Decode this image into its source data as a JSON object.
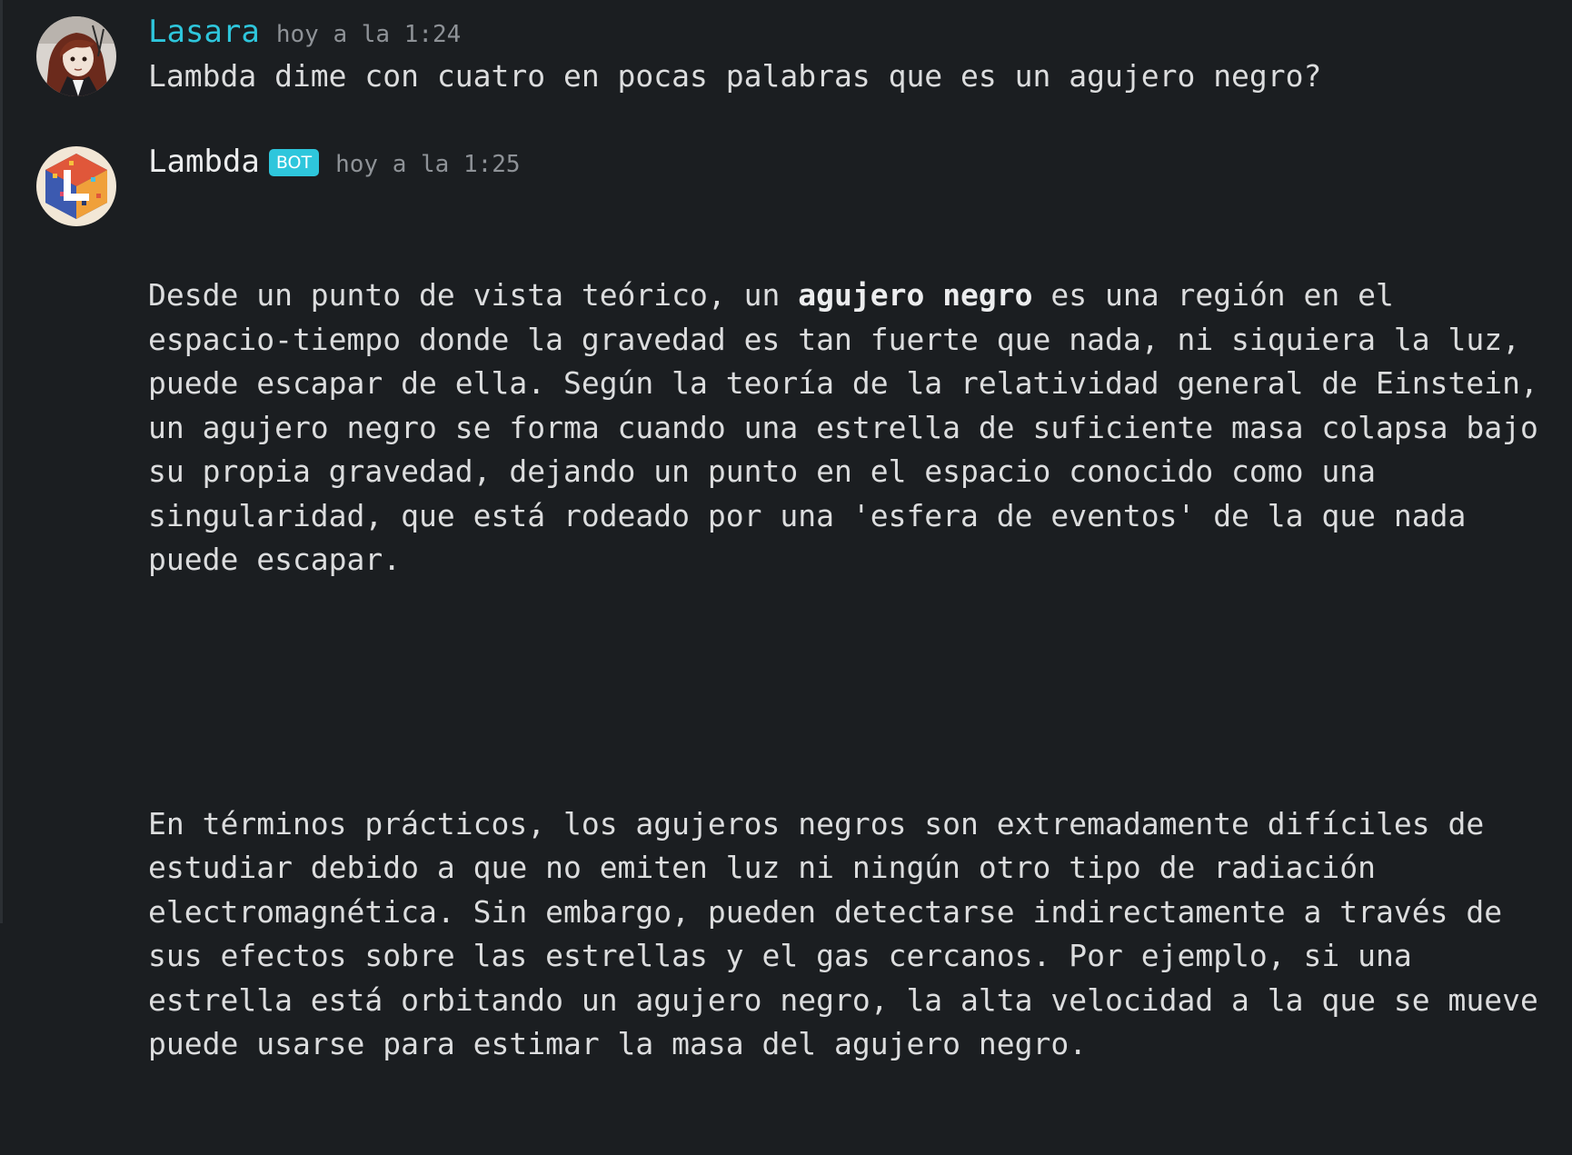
{
  "messages": [
    {
      "author": "Lasara",
      "timestamp": "hoy a la 1:24",
      "avatar_icon": "user-avatar-illustration",
      "text": "Lambda dime con cuatro en pocas palabras que es un agujero negro?"
    },
    {
      "author": "Lambda",
      "badge": "BOT",
      "timestamp": "hoy a la 1:25",
      "avatar_icon": "lambda-bot-logo",
      "paragraph1": {
        "lead": "Desde un punto de vista teórico, un ",
        "bold": "agujero negro",
        "rest": " es una región en el espacio-tiempo donde la gravedad es tan fuerte que nada, ni siquiera la luz, puede escapar de ella. Según la teoría de la relatividad general de Einstein, un agujero negro se forma cuando una estrella de suficiente masa colapsa bajo su propia gravedad, dejando un punto en el espacio conocido como una singularidad, que está rodeado por una 'esfera de eventos' de la que nada puede escapar."
      },
      "paragraph2": "En términos prácticos, los agujeros negros son extremadamente difíciles de estudiar debido a que no emiten luz ni ningún otro tipo de radiación electromagnética. Sin embargo, pueden detectarse indirectamente a través de sus efectos sobre las estrellas y el gas cercanos. Por ejemplo, si una estrella está orbitando un agujero negro, la alta velocidad a la que se mueve puede usarse para estimar la masa del agujero negro."
    }
  ],
  "colors": {
    "background": "#1b1e21",
    "user_name": "#2ec6dc",
    "bot_badge": "#2ec6dc",
    "timestamp": "#8e9297",
    "text": "#dcddde"
  }
}
